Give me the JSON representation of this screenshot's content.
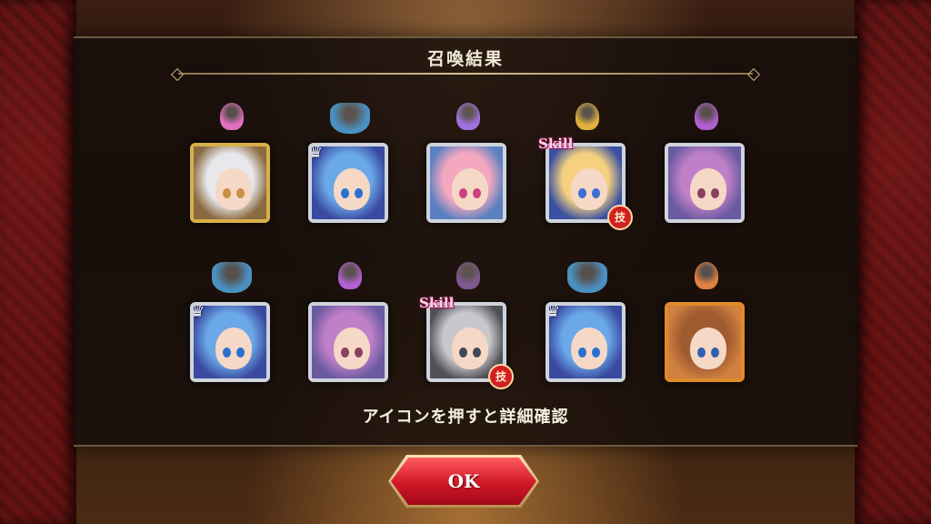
{
  "header": {
    "title": "召喚結果"
  },
  "hint": "アイコンを押すと詳細確認",
  "ok_button": {
    "label": "OK"
  },
  "skill_badge": "Skill",
  "waza_badge": "技",
  "results": [
    {
      "name": "silver-hair-horned-girl",
      "frame": "gold",
      "sprite": "fairy-pink",
      "hair": "#e8e8ec",
      "eye": "#c89040",
      "skill": false,
      "crown": false,
      "bg": "#8a6a40"
    },
    {
      "name": "blue-hair-girl",
      "frame": "silver",
      "sprite": "dragon",
      "hair": "#6aa8e8",
      "eye": "#2a70d0",
      "skill": false,
      "crown": true,
      "bg": "#3a4aa0"
    },
    {
      "name": "pink-hair-girl",
      "frame": "silver",
      "sprite": "fairy-blue",
      "hair": "#f4a8c0",
      "eye": "#d04080",
      "skill": false,
      "crown": false,
      "bg": "#5a80c0"
    },
    {
      "name": "blonde-hair-girl",
      "frame": "silver",
      "sprite": "fairy-gold",
      "hair": "#f4d080",
      "eye": "#3a70d0",
      "skill": true,
      "crown": false,
      "bg": "#3a50a0"
    },
    {
      "name": "violet-hair-girl",
      "frame": "silver",
      "sprite": "fairy-violet",
      "hair": "#c080c8",
      "eye": "#8a4060",
      "skill": false,
      "crown": false,
      "bg": "#6a5aa0"
    },
    {
      "name": "blue-hair-girl",
      "frame": "silver",
      "sprite": "dragon",
      "hair": "#6aa8e8",
      "eye": "#2a70d0",
      "skill": false,
      "crown": true,
      "bg": "#3a4aa0"
    },
    {
      "name": "violet-hair-girl",
      "frame": "silver",
      "sprite": "fairy-violet",
      "hair": "#c080c8",
      "eye": "#8a4060",
      "skill": false,
      "crown": false,
      "bg": "#6a5aa0"
    },
    {
      "name": "silver-hair-girl",
      "frame": "silver",
      "sprite": "fairy-dark",
      "hair": "#c8c8cc",
      "eye": "#404858",
      "skill": true,
      "crown": false,
      "bg": "#505058"
    },
    {
      "name": "blue-hair-girl",
      "frame": "silver",
      "sprite": "dragon",
      "hair": "#6aa8e8",
      "eye": "#2a70d0",
      "skill": false,
      "crown": true,
      "bg": "#3a4aa0"
    },
    {
      "name": "brown-hair-girl",
      "frame": "orange",
      "sprite": "fairy-orange",
      "hair": "#a05a30",
      "eye": "#3060b0",
      "skill": false,
      "crown": false,
      "bg": "#d08040"
    }
  ],
  "colors": {
    "panel": "#16100a",
    "ok_button": "#d01828",
    "side_frame": "#5a1212"
  }
}
